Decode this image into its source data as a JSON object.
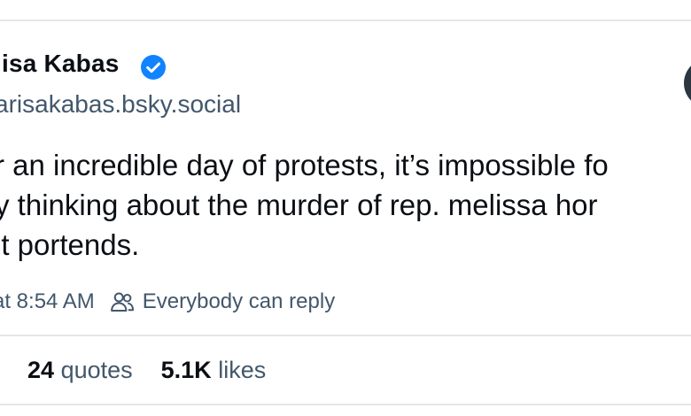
{
  "post": {
    "author_name": "lisa Kabas",
    "handle": "arisakabas.bsky.social",
    "text_lines": [
      "r an incredible day of protests, it’s impossible fo",
      "y thinking about the murder of rep. melissa hor",
      "it portends."
    ],
    "timestamp": "at 8:54 AM",
    "reply_setting": "Everybody can reply",
    "badge_color": "#1083fe"
  },
  "stats": {
    "quotes_count": "24",
    "quotes_label": "quotes",
    "likes_count": "5.1K",
    "likes_label": "likes"
  },
  "icons": {
    "verified": "verified-check-icon",
    "reply_setting": "people-icon"
  }
}
